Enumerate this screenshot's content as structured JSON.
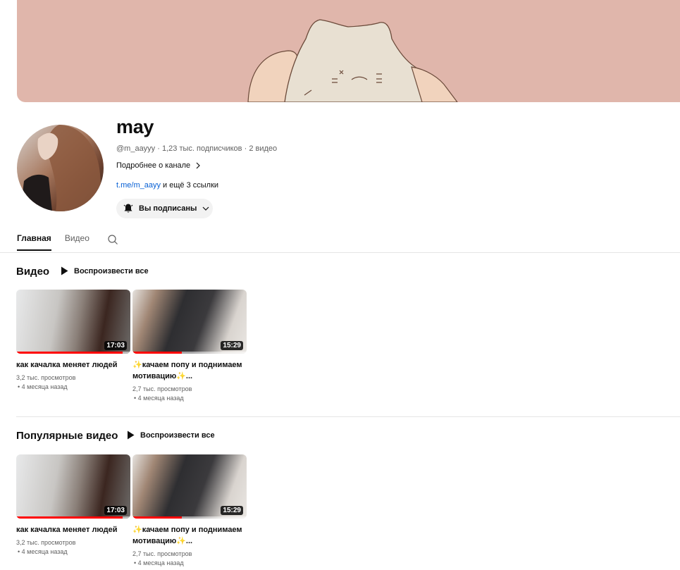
{
  "channel": {
    "name": "may",
    "handle": "@m_aayyy",
    "subscribers": "1,23 тыс. подписчиков",
    "video_count": "2 видео",
    "about_label": "Подробнее о канале",
    "link_text": "t.me/m_aayy",
    "more_links": "и ещё 3 ссылки",
    "subscribe_label": "Вы подписаны"
  },
  "tabs": [
    {
      "label": "Главная",
      "active": true
    },
    {
      "label": "Видео",
      "active": false
    }
  ],
  "sections": [
    {
      "title": "Видео",
      "play_all": "Воспроизвести все",
      "videos": [
        {
          "title": "как качалка меняет людей",
          "views": "3,2 тыс. просмотров",
          "date": "• 4 месяца назад",
          "duration": "17:03",
          "progress": 0.93
        },
        {
          "title": "✨качаем попу и поднимаем мотивацию✨...",
          "views": "2,7 тыс. просмотров",
          "date": "• 4 месяца назад",
          "duration": "15:29",
          "progress": 0.43
        }
      ]
    },
    {
      "title": "Популярные видео",
      "play_all": "Воспроизвести все",
      "videos": [
        {
          "title": "как качалка меняет людей",
          "views": "3,2 тыс. просмотров",
          "date": "• 4 месяца назад",
          "duration": "17:03",
          "progress": 0.93
        },
        {
          "title": "✨качаем попу и поднимаем мотивацию✨...",
          "views": "2,7 тыс. просмотров",
          "date": "• 4 месяца назад",
          "duration": "15:29",
          "progress": 0.43
        }
      ]
    }
  ],
  "colors": {
    "banner": "#e0b6ab",
    "progress": "#ff0000",
    "link": "#065fd4"
  },
  "icons": {
    "about": "chevron-right-icon",
    "subscribe": "bell-icon",
    "dropdown": "chevron-down-icon",
    "search": "search-icon",
    "play": "play-icon"
  }
}
